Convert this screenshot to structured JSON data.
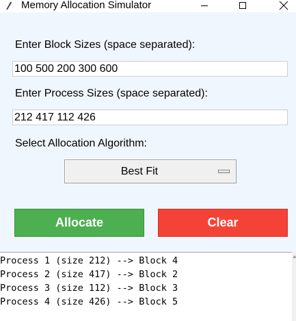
{
  "window": {
    "title": "Memory Allocation Simulator",
    "icon": "feather-icon",
    "controls": [
      "minimize-icon",
      "maximize-icon",
      "close-icon"
    ]
  },
  "form": {
    "block_label": "Enter Block Sizes (space separated):",
    "block_value": "100 500 200 300 600",
    "process_label": "Enter Process Sizes (space separated):",
    "process_value": "212 417 112 426",
    "algorithm_label": "Select Allocation Algorithm:",
    "algorithm_selected": "Best Fit"
  },
  "buttons": {
    "allocate": "Allocate",
    "clear": "Clear"
  },
  "output": {
    "lines": [
      "Process 1 (size 212) --> Block 4",
      "Process 2 (size 417) --> Block 2",
      "Process 3 (size 112) --> Block 3",
      "Process 4 (size 426) --> Block 5"
    ]
  },
  "colors": {
    "client_background": "#f0f6fe",
    "allocate_button": "#4caf50",
    "clear_button": "#f44336",
    "button_text": "#ffffff"
  }
}
